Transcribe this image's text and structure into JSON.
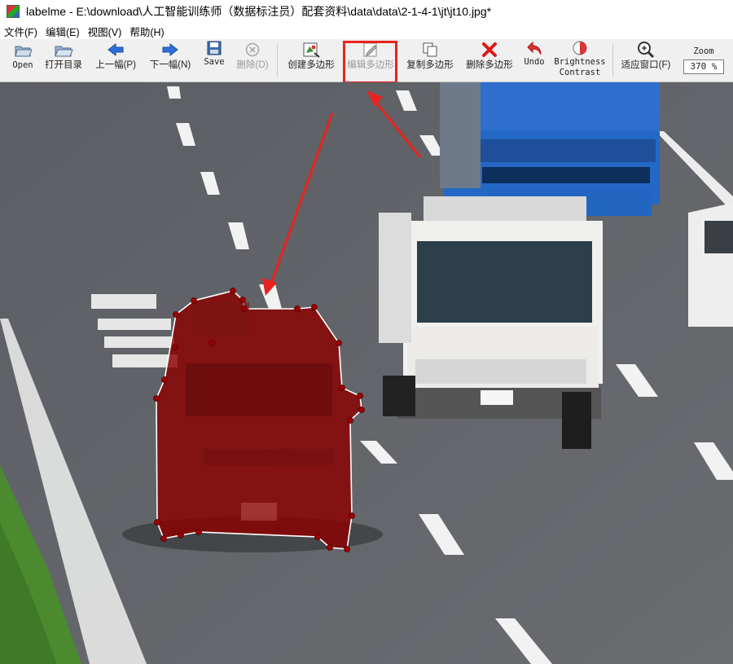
{
  "window": {
    "title": "labelme - E:\\download\\人工智能训练师（数据标注员）配套资料\\data\\data\\2-1-4-1\\jt\\jt10.jpg*"
  },
  "menu": {
    "items": [
      {
        "label": "文件(F)"
      },
      {
        "label": "编辑(E)"
      },
      {
        "label": "视图(V)"
      },
      {
        "label": "帮助(H)"
      }
    ]
  },
  "toolbar": {
    "open": "Open",
    "open_dir": "打开目录",
    "prev": "上一幅(P)",
    "next": "下一幅(N)",
    "save": "Save",
    "delete": "删除(D)",
    "create_polygon": "创建多边形",
    "edit_polygon": "编辑多边形",
    "copy_polygon": "复制多边形",
    "delete_polygon": "删除多边形",
    "undo": "Undo",
    "brightness": "Brightness",
    "contrast": "Contrast",
    "fit_window": "适应窗口(F)",
    "zoom_label": "Zoom",
    "zoom_value": "370 %"
  },
  "colors": {
    "highlight": "#e8231f",
    "polygon_fill": "#8b0000",
    "accent_blue": "#2d6fd6"
  }
}
